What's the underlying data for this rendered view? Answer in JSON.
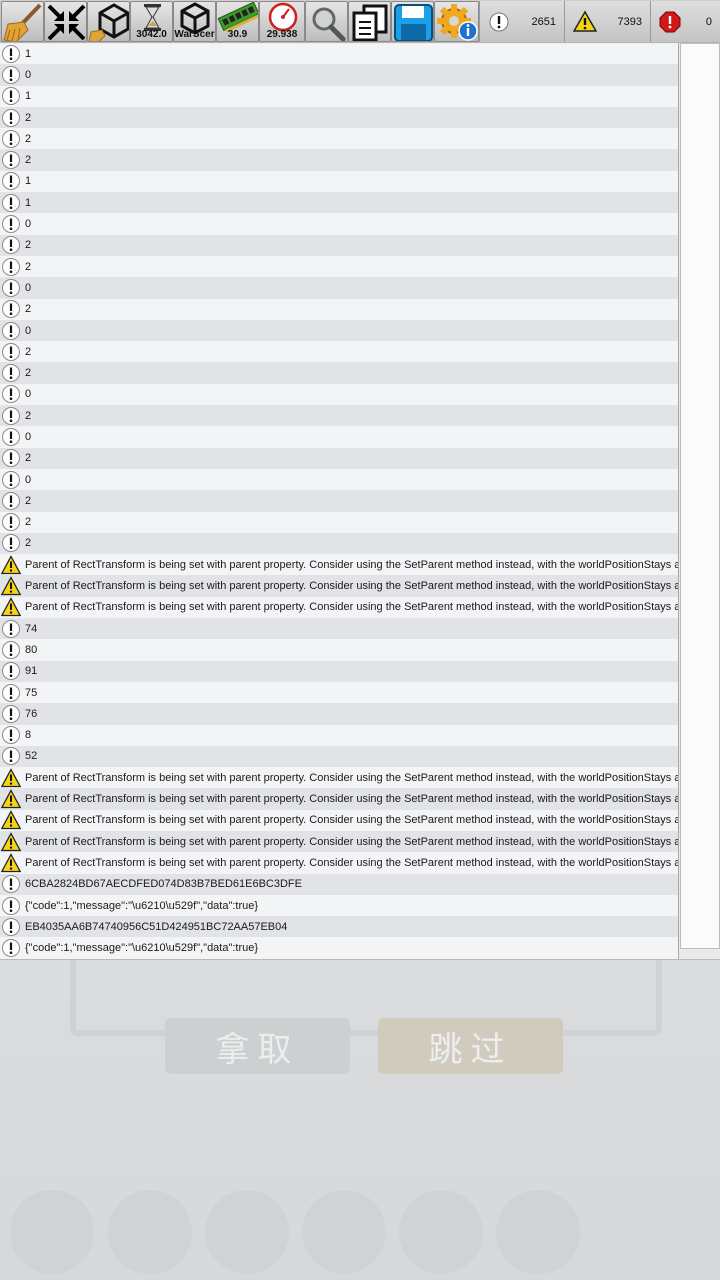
{
  "toolbar": {
    "buttons": [
      {
        "name": "clear-button",
        "icon": "broom-icon",
        "value": ""
      },
      {
        "name": "collapse-button",
        "icon": "collapse-arrows-icon",
        "value": ""
      },
      {
        "name": "unity-clear-on-load-button",
        "icon": "unity-broom-icon",
        "value": ""
      },
      {
        "name": "time-button",
        "icon": "hourglass-icon",
        "value": "3042.0"
      },
      {
        "name": "scene-button",
        "icon": "unity-logo-icon",
        "value": "WarScer"
      },
      {
        "name": "memory-button",
        "icon": "memory-chip-icon",
        "value": "30.9"
      },
      {
        "name": "fps-button",
        "icon": "speedometer-icon",
        "value": "29.938"
      },
      {
        "name": "search-button",
        "icon": "magnifier-icon",
        "value": ""
      },
      {
        "name": "copy-button",
        "icon": "copy-icon",
        "value": ""
      },
      {
        "name": "save-button",
        "icon": "floppy-disk-icon",
        "value": ""
      },
      {
        "name": "settings-button",
        "icon": "gear-info-icon",
        "value": ""
      }
    ],
    "counts": {
      "log": "2651",
      "warning": "7393",
      "error": "0"
    }
  },
  "logs": [
    {
      "type": "log",
      "text": "1"
    },
    {
      "type": "log",
      "text": "0"
    },
    {
      "type": "log",
      "text": "1"
    },
    {
      "type": "log",
      "text": "2"
    },
    {
      "type": "log",
      "text": "2"
    },
    {
      "type": "log",
      "text": "2"
    },
    {
      "type": "log",
      "text": "1"
    },
    {
      "type": "log",
      "text": "1"
    },
    {
      "type": "log",
      "text": "0"
    },
    {
      "type": "log",
      "text": "2"
    },
    {
      "type": "log",
      "text": "2"
    },
    {
      "type": "log",
      "text": "0"
    },
    {
      "type": "log",
      "text": "2"
    },
    {
      "type": "log",
      "text": "0"
    },
    {
      "type": "log",
      "text": "2"
    },
    {
      "type": "log",
      "text": "2"
    },
    {
      "type": "log",
      "text": "0"
    },
    {
      "type": "log",
      "text": "2"
    },
    {
      "type": "log",
      "text": "0"
    },
    {
      "type": "log",
      "text": "2"
    },
    {
      "type": "log",
      "text": "0"
    },
    {
      "type": "log",
      "text": "2"
    },
    {
      "type": "log",
      "text": "2"
    },
    {
      "type": "log",
      "text": "2"
    },
    {
      "type": "warning",
      "text": "Parent of RectTransform is being set with parent property. Consider using the SetParent method instead, with the worldPositionStays argur"
    },
    {
      "type": "warning",
      "text": "Parent of RectTransform is being set with parent property. Consider using the SetParent method instead, with the worldPositionStays argur"
    },
    {
      "type": "warning",
      "text": "Parent of RectTransform is being set with parent property. Consider using the SetParent method instead, with the worldPositionStays argur"
    },
    {
      "type": "log",
      "text": "74"
    },
    {
      "type": "log",
      "text": "80"
    },
    {
      "type": "log",
      "text": "91"
    },
    {
      "type": "log",
      "text": "75"
    },
    {
      "type": "log",
      "text": "76"
    },
    {
      "type": "log",
      "text": "8"
    },
    {
      "type": "log",
      "text": "52"
    },
    {
      "type": "warning",
      "text": "Parent of RectTransform is being set with parent property. Consider using the SetParent method instead, with the worldPositionStays argur"
    },
    {
      "type": "warning",
      "text": "Parent of RectTransform is being set with parent property. Consider using the SetParent method instead, with the worldPositionStays argur"
    },
    {
      "type": "warning",
      "text": "Parent of RectTransform is being set with parent property. Consider using the SetParent method instead, with the worldPositionStays argur"
    },
    {
      "type": "warning",
      "text": "Parent of RectTransform is being set with parent property. Consider using the SetParent method instead, with the worldPositionStays argur"
    },
    {
      "type": "warning",
      "text": "Parent of RectTransform is being set with parent property. Consider using the SetParent method instead, with the worldPositionStays argur"
    },
    {
      "type": "log",
      "text": "6CBA2824BD67AECDFED074D83B7BED61E6BC3DFE"
    },
    {
      "type": "log",
      "text": "{\"code\":1,\"message\":\"\\u6210\\u529f\",\"data\":true}"
    },
    {
      "type": "log",
      "text": "EB4035AA6B74740956C51D424951BC72AA57EB04"
    },
    {
      "type": "log",
      "text": "{\"code\":1,\"message\":\"\\u6210\\u529f\",\"data\":true}"
    }
  ],
  "game": {
    "take_button": "拿取",
    "skip_button": "跳过"
  }
}
